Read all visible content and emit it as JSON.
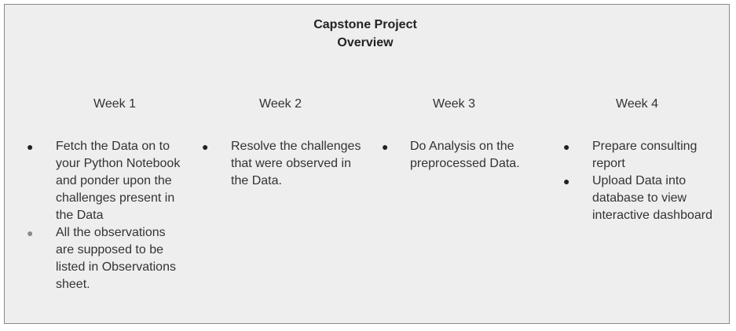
{
  "title": {
    "line1": "Capstone Project",
    "line2": "Overview"
  },
  "weeks": [
    {
      "label": "Week 1",
      "items": [
        [
          "Fetch the Data on to",
          "your Python Notebook",
          "and ponder upon the",
          "challenges present in",
          "the Data"
        ],
        [
          "All the observations",
          "are supposed to be",
          "listed in Observations",
          "sheet."
        ]
      ]
    },
    {
      "label": "Week 2",
      "items": [
        [
          "Resolve the challenges",
          "that were observed in",
          "the Data."
        ]
      ]
    },
    {
      "label": "Week 3",
      "items": [
        [
          "Do Analysis on the",
          "preprocessed Data."
        ]
      ]
    },
    {
      "label": "Week 4",
      "items": [
        [
          "Prepare consulting",
          "report"
        ],
        [
          "Upload Data into",
          "database to view",
          "interactive dashboard"
        ]
      ]
    }
  ],
  "bullet_glyph": "●",
  "colors": {
    "panel_background": "#eeeeee",
    "panel_border": "#8a8a8a",
    "text": "#333333"
  }
}
